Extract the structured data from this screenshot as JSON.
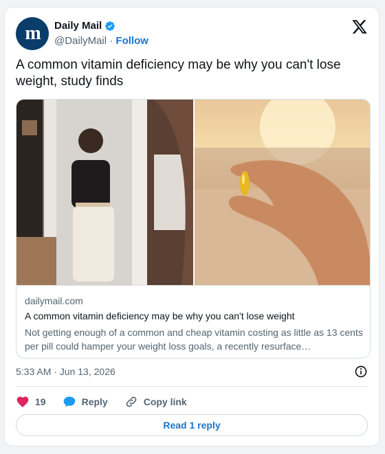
{
  "account": {
    "name": "Daily Mail",
    "handle": "@DailyMail",
    "separator": "·",
    "follow_label": "Follow",
    "avatar_letters": "m"
  },
  "tweet": {
    "text": "A common vitamin deficiency may be why you can't lose weight, study finds"
  },
  "card": {
    "domain": "dailymail.com",
    "title": "A common vitamin deficiency may be why you can't lose weight",
    "description": "Not getting enough of a common and cheap vitamin costing as little as 13 cents per pill could hamper your weight loss goals, a recently resurface…"
  },
  "meta": {
    "timestamp": "5:33 AM · Jun 13, 2026"
  },
  "actions": {
    "like_count": "19",
    "reply_label": "Reply",
    "copy_label": "Copy link"
  },
  "footer": {
    "read_reply_label": "Read 1 reply"
  },
  "icons": {
    "verified": "verified-badge-icon",
    "x_logo": "x-logo-icon",
    "info": "info-icon",
    "heart": "heart-icon",
    "reply": "speech-bubble-icon",
    "link": "link-icon"
  },
  "colors": {
    "accent": "#1d74c9",
    "heart": "#e0245e",
    "reply_bubble": "#1d9bf0",
    "avatar_bg": "#0b3d6b"
  }
}
